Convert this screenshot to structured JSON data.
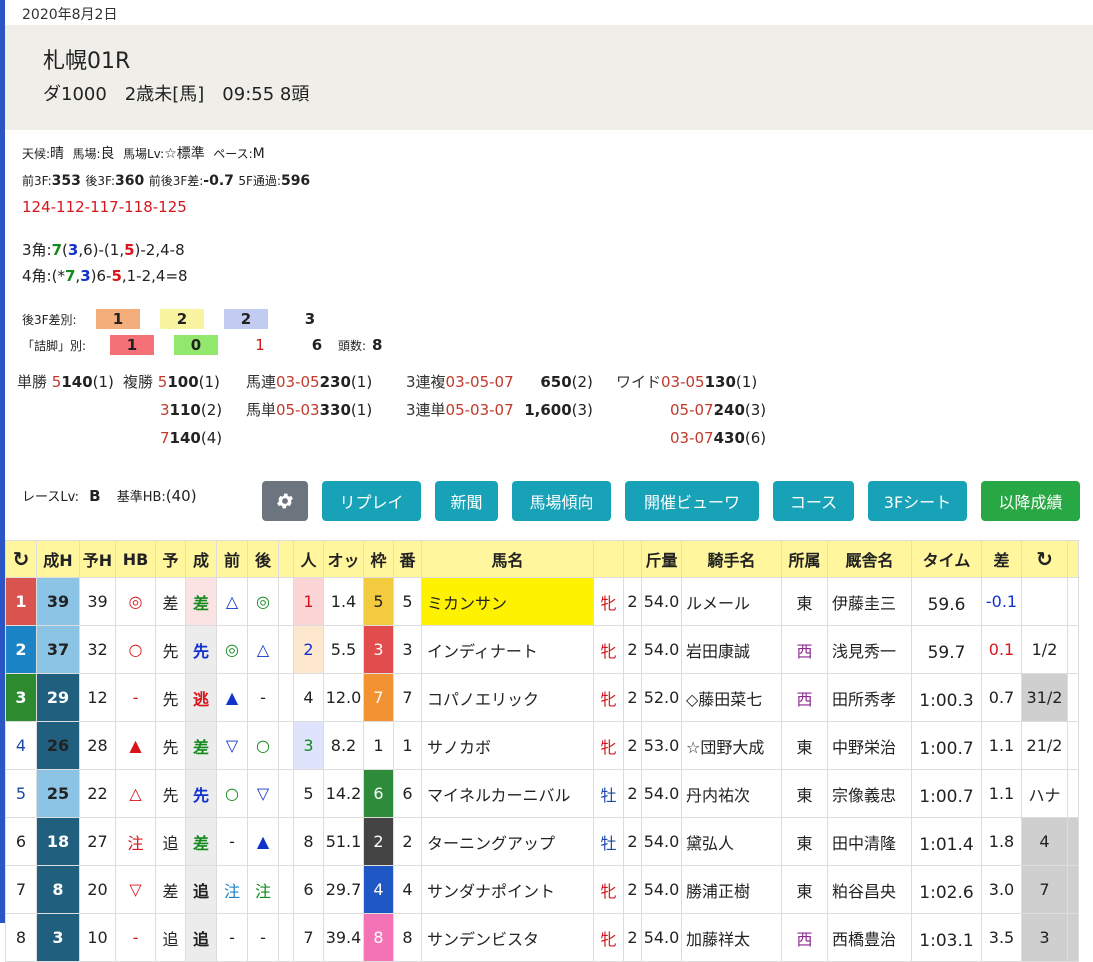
{
  "date": "2020年8月2日",
  "race": {
    "name": "札幌01R",
    "subtitle": "ダ1000　2歳未[馬]　09:55 8頭"
  },
  "conditions": {
    "weather_label": "天候:",
    "weather": "晴",
    "track_label": "馬場:",
    "track": "良",
    "lv_label": "馬場Lv:",
    "lv": "☆標準",
    "pace_label": "ペース:",
    "pace": "M"
  },
  "split": {
    "f3_label": "前3F:",
    "f3": "353",
    "l3_label": "後3F:",
    "l3": "360",
    "diff_label": "前後3F差:",
    "diff": "-0.7",
    "f5_label": "5F通過:",
    "f5": "596"
  },
  "laps": "124-112-117-118-125",
  "corner3": {
    "label": "3角:",
    "p1": "7",
    "p2": "(",
    "p3": "3",
    "p4": ",6)-(1,",
    "p5": "5",
    "p6": ")-2,4-8"
  },
  "corner4": {
    "label": "4角:",
    "p1": "(*",
    "p2": "7",
    "p3": ",",
    "p4": "3",
    "p5": ")6-",
    "p6": "5",
    "p7": ",1-2,4=8"
  },
  "rank3f": {
    "label": "後3F差別:",
    "v1": "1",
    "v2": "2",
    "v3": "2",
    "v4": "3"
  },
  "tsume": {
    "label": "「詰脚」別:",
    "v1": "1",
    "v2": "0",
    "v3": "1",
    "v4": "6",
    "heads_label": "頭数:",
    "heads": "8"
  },
  "payouts": {
    "tansho": {
      "label": "単勝",
      "combo": "5",
      "amount": "140",
      "pop": "(1)"
    },
    "fukusho": {
      "label": "複勝",
      "rows": [
        {
          "combo": "5",
          "amount": "100",
          "pop": "(1)"
        },
        {
          "combo": "3",
          "amount": "110",
          "pop": "(2)"
        },
        {
          "combo": "7",
          "amount": "140",
          "pop": "(4)"
        }
      ]
    },
    "umaren": {
      "label": "馬連",
      "combo": "03-05",
      "amount": "230",
      "pop": "(1)"
    },
    "umatan": {
      "label": "馬単",
      "combo": "05-03",
      "amount": "330",
      "pop": "(1)"
    },
    "sanrenpuku": {
      "label": "3連複",
      "combo": "03-05-07",
      "amount": "650",
      "pop": "(2)"
    },
    "sanrentan": {
      "label": "3連単",
      "combo": "05-03-07",
      "amount": "1,600",
      "pop": "(3)"
    },
    "wide": {
      "label": "ワイド",
      "rows": [
        {
          "combo": "03-05",
          "amount": "130",
          "pop": "(1)"
        },
        {
          "combo": "05-07",
          "amount": "240",
          "pop": "(3)"
        },
        {
          "combo": "03-07",
          "amount": "430",
          "pop": "(6)"
        }
      ]
    }
  },
  "race_level": {
    "label": "レースLv:",
    "value": "B",
    "hb_label": "基準HB:",
    "hb": "(40)"
  },
  "buttons": {
    "gear": "gear-icon",
    "replay": "リプレイ",
    "news": "新聞",
    "trend": "馬場傾向",
    "viewer": "開催ビューワ",
    "course": "コース",
    "sheet": "3Fシート",
    "later": "以降成績"
  },
  "colors": {
    "teal": "#17a2b8",
    "green": "#28a745",
    "gray": "#6c757d",
    "header_yellow": "#fff69e"
  },
  "table": {
    "headers": [
      "↻",
      "成H",
      "予H",
      "HB",
      "予",
      "成",
      "前",
      "後",
      "",
      "人",
      "オッ",
      "枠",
      "番",
      "馬名",
      "",
      "",
      "斤量",
      "騎手名",
      "所属",
      "厩舎名",
      "タイム",
      "差",
      "↻",
      ""
    ],
    "rows": [
      [
        "1",
        "39",
        "39",
        "◎",
        "差",
        "差",
        "△",
        "◎",
        "",
        "1",
        "1.4",
        "5",
        "5",
        "ミカンサン",
        "牝",
        "2",
        "54.0",
        "ルメール",
        "東",
        "伊藤圭三",
        "59.6",
        "-0.1",
        "",
        ""
      ],
      [
        "2",
        "37",
        "32",
        "○",
        "先",
        "先",
        "◎",
        "△",
        "",
        "2",
        "5.5",
        "3",
        "3",
        "インディナート",
        "牝",
        "2",
        "54.0",
        "岩田康誠",
        "西",
        "浅見秀一",
        "59.7",
        "0.1",
        "1/2",
        ""
      ],
      [
        "3",
        "29",
        "12",
        "-",
        "先",
        "逃",
        "▲",
        "-",
        "",
        "4",
        "12.0",
        "7",
        "7",
        "コパノエリック",
        "牝",
        "2",
        "52.0",
        "◇藤田菜七",
        "西",
        "田所秀孝",
        "1:00.3",
        "0.7",
        "31/2",
        ""
      ],
      [
        "4",
        "26",
        "28",
        "▲",
        "先",
        "差",
        "▽",
        "○",
        "",
        "3",
        "8.2",
        "1",
        "1",
        "サノカボ",
        "牝",
        "2",
        "53.0",
        "☆団野大成",
        "東",
        "中野栄治",
        "1:00.7",
        "1.1",
        "21/2",
        ""
      ],
      [
        "5",
        "25",
        "22",
        "△",
        "先",
        "先",
        "○",
        "▽",
        "",
        "5",
        "14.2",
        "6",
        "6",
        "マイネルカーニバル",
        "牡",
        "2",
        "54.0",
        "丹内祐次",
        "東",
        "宗像義忠",
        "1:00.7",
        "1.1",
        "ハナ",
        ""
      ],
      [
        "6",
        "18",
        "27",
        "注",
        "追",
        "差",
        "-",
        "▲",
        "",
        "8",
        "51.1",
        "2",
        "2",
        "ターニングアップ",
        "牡",
        "2",
        "54.0",
        "黛弘人",
        "東",
        "田中清隆",
        "1:01.4",
        "1.8",
        "4",
        ""
      ],
      [
        "7",
        "8",
        "20",
        "▽",
        "差",
        "追",
        "注",
        "注",
        "",
        "6",
        "29.7",
        "4",
        "4",
        "サンダナポイント",
        "牝",
        "2",
        "54.0",
        "勝浦正樹",
        "東",
        "粕谷昌央",
        "1:02.6",
        "3.0",
        "7",
        ""
      ],
      [
        "8",
        "3",
        "10",
        "-",
        "追",
        "追",
        "-",
        "-",
        "",
        "7",
        "39.4",
        "8",
        "8",
        "サンデンビスタ",
        "牝",
        "2",
        "54.0",
        "加藤祥太",
        "西",
        "西橋豊治",
        "1:03.1",
        "3.5",
        "3",
        ""
      ]
    ]
  }
}
